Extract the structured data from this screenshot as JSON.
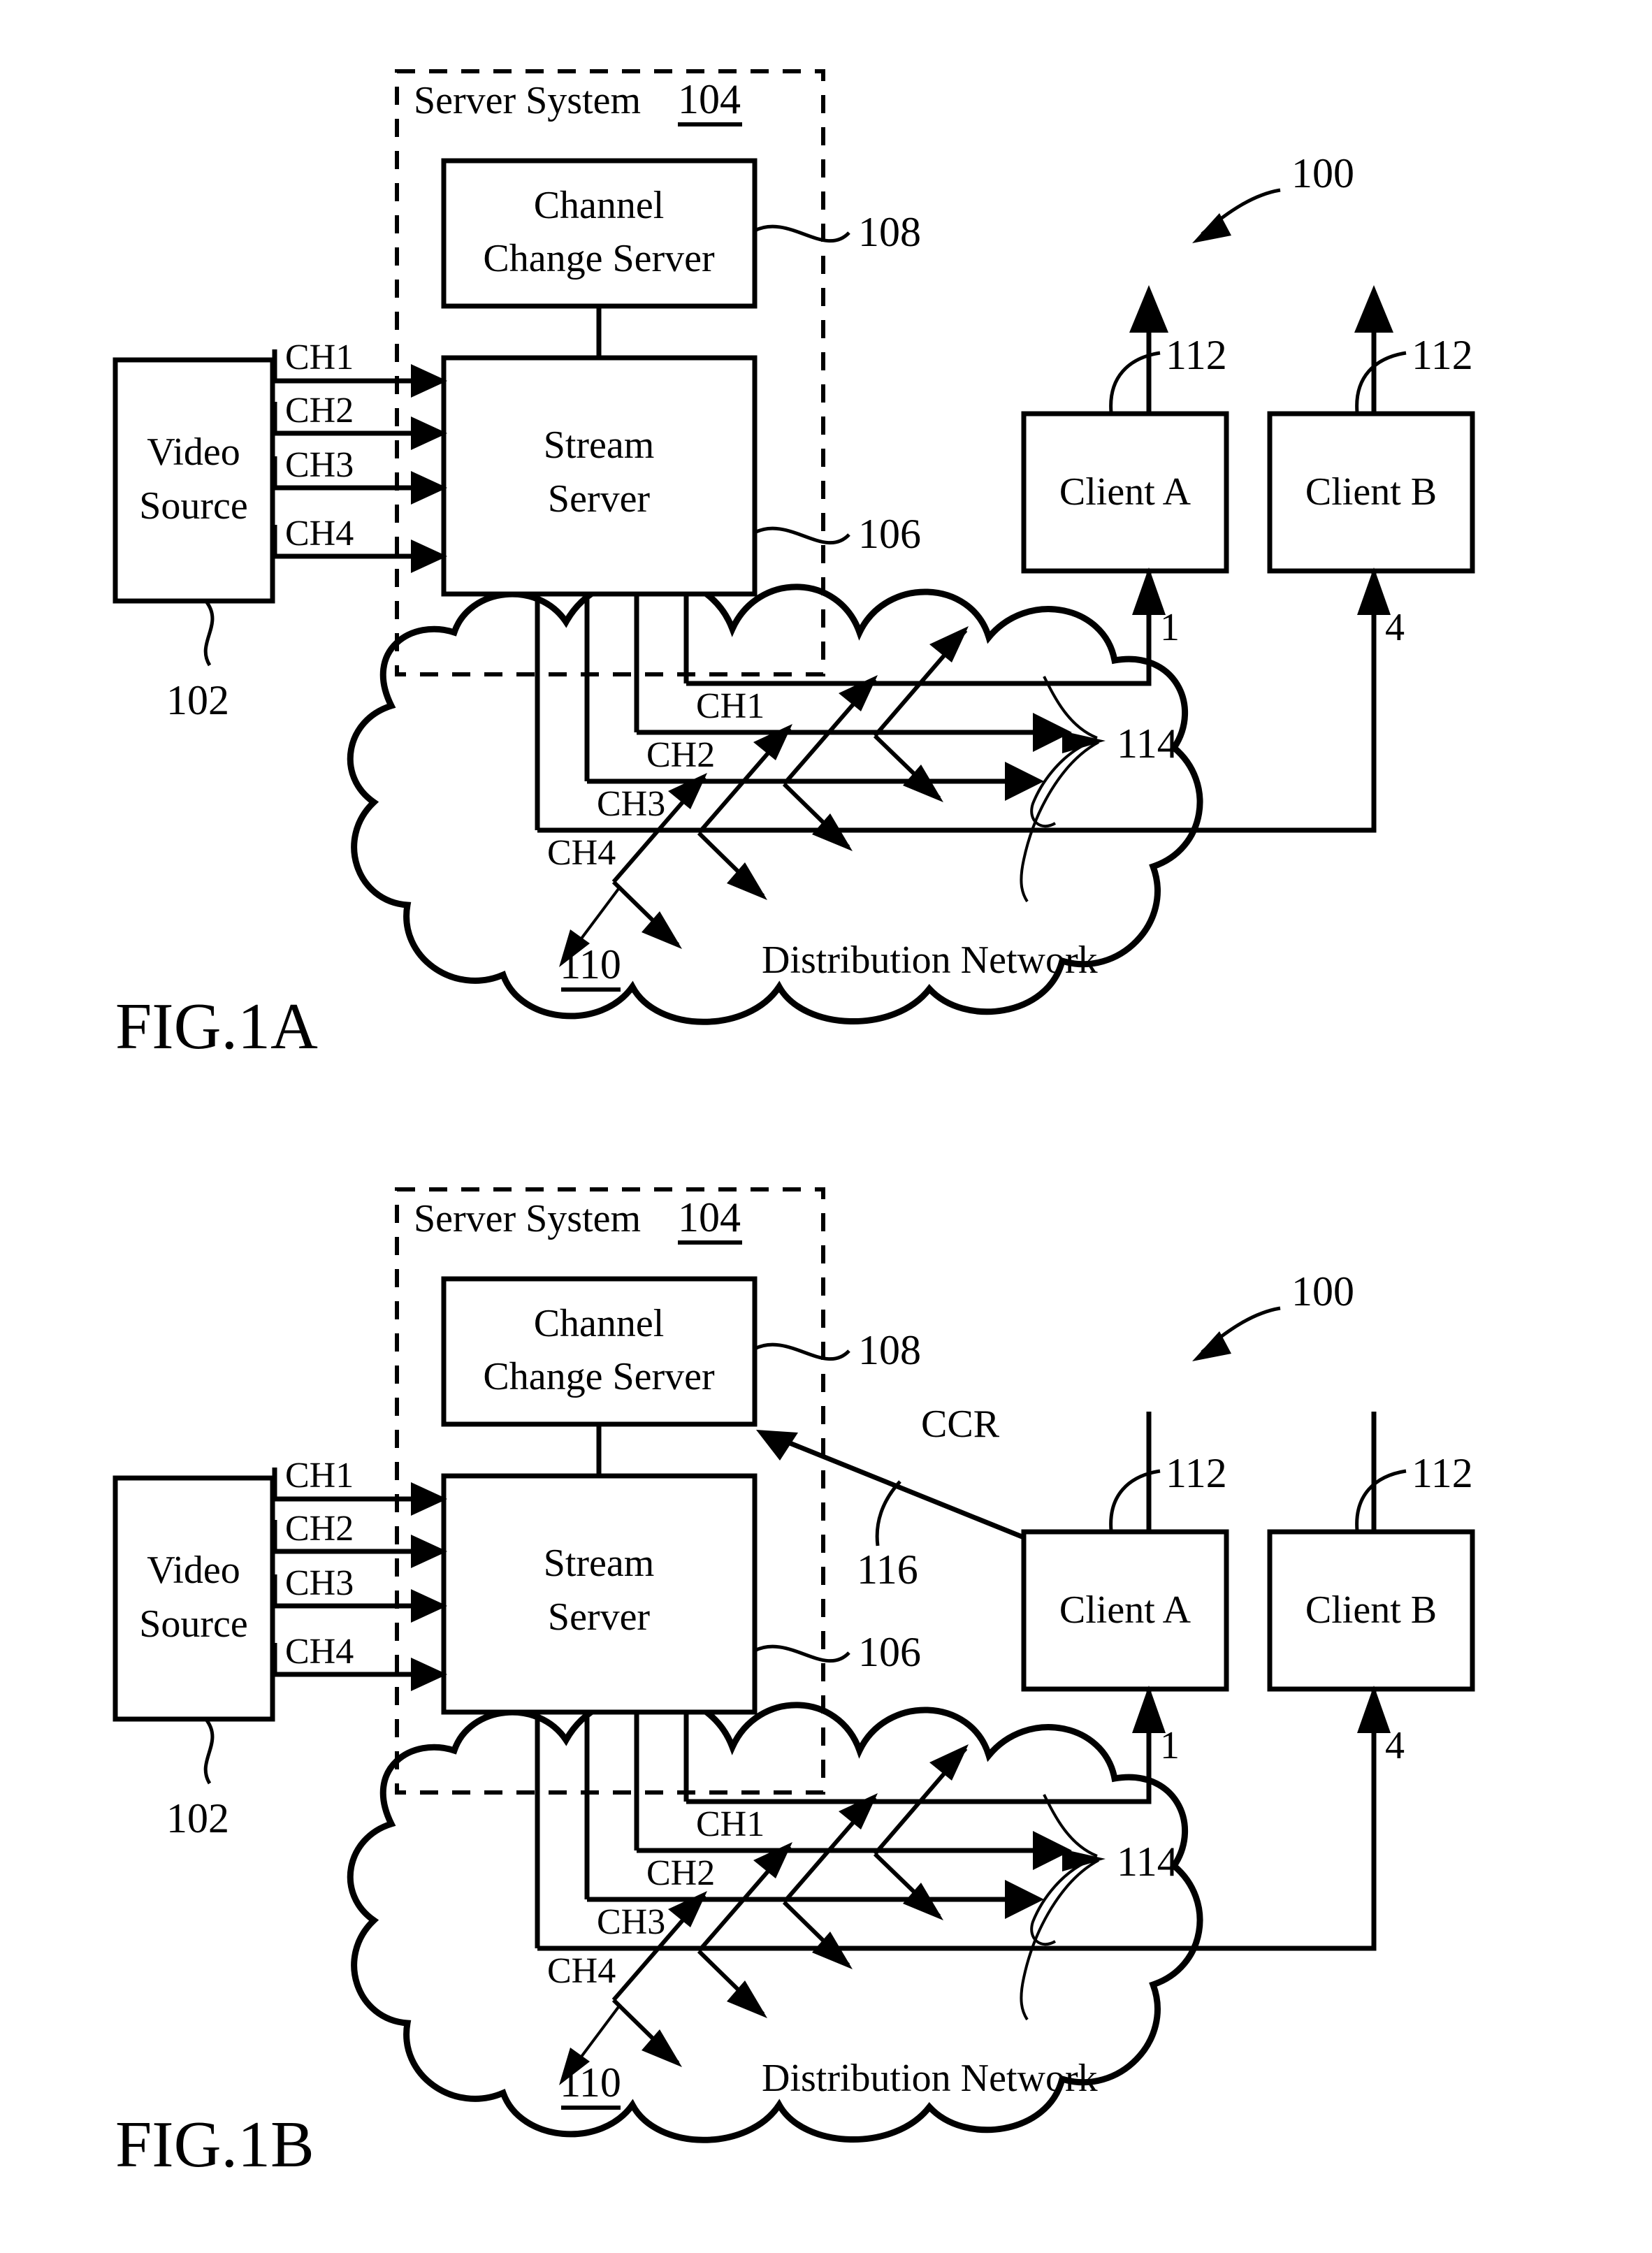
{
  "figures": [
    {
      "title": "FIG.1A",
      "system_ref": "100",
      "server_system": {
        "label": "Server System",
        "ref": "104",
        "channel_change_server": {
          "line1": "Channel",
          "line2": "Change Server",
          "ref": "108"
        },
        "stream_server": {
          "line1": "Stream",
          "line2": "Server",
          "ref": "106"
        }
      },
      "video_source": {
        "line1": "Video",
        "line2": "Source",
        "ref": "102"
      },
      "source_channels": [
        "CH1",
        "CH2",
        "CH3",
        "CH4"
      ],
      "network": {
        "label": "Distribution Network",
        "ref": "110",
        "node_ref": "114",
        "channels": [
          "CH1",
          "CH2",
          "CH3",
          "CH4"
        ]
      },
      "clients": [
        {
          "label": "Client A",
          "ref": "112",
          "channel_number": "1"
        },
        {
          "label": "Client B",
          "ref": "112",
          "channel_number": "4"
        }
      ],
      "ccr": null
    },
    {
      "title": "FIG.1B",
      "system_ref": "100",
      "server_system": {
        "label": "Server System",
        "ref": "104",
        "channel_change_server": {
          "line1": "Channel",
          "line2": "Change Server",
          "ref": "108"
        },
        "stream_server": {
          "line1": "Stream",
          "line2": "Server",
          "ref": "106"
        }
      },
      "video_source": {
        "line1": "Video",
        "line2": "Source",
        "ref": "102"
      },
      "source_channels": [
        "CH1",
        "CH2",
        "CH3",
        "CH4"
      ],
      "network": {
        "label": "Distribution Network",
        "ref": "110",
        "node_ref": "114",
        "channels": [
          "CH1",
          "CH2",
          "CH3",
          "CH4"
        ]
      },
      "clients": [
        {
          "label": "Client A",
          "ref": "112",
          "channel_number": "1"
        },
        {
          "label": "Client B",
          "ref": "112",
          "channel_number": "4"
        }
      ],
      "ccr": {
        "label": "CCR",
        "ref": "116"
      }
    }
  ],
  "colors": {
    "ink": "#000000",
    "paper": "#ffffff"
  }
}
